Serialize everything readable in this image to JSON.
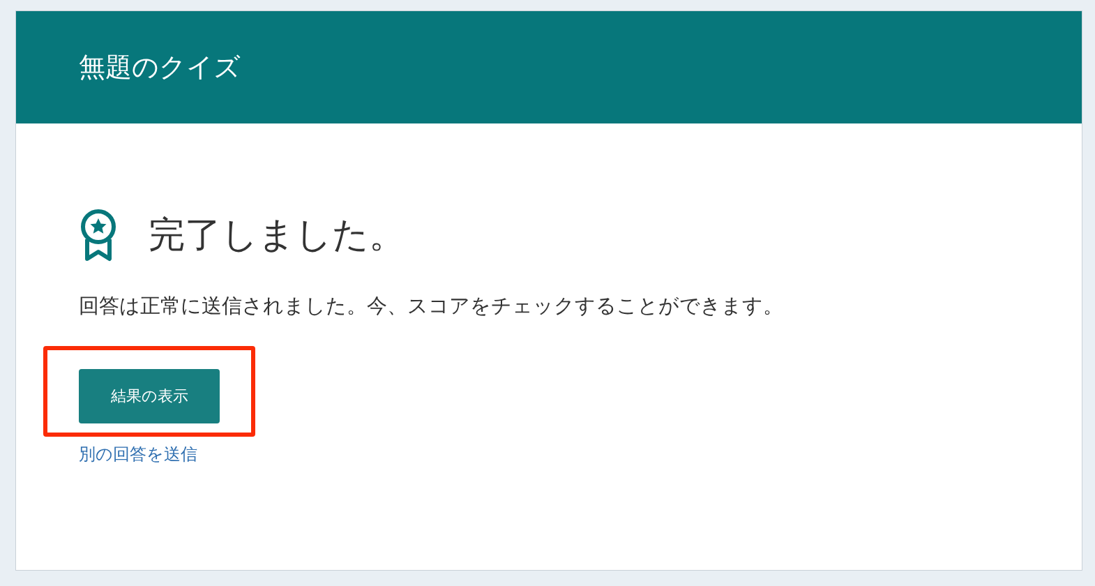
{
  "header": {
    "title": "無題のクイズ"
  },
  "completion": {
    "heading": "完了しました。",
    "message": "回答は正常に送信されました。今、スコアをチェックすることができます。"
  },
  "results_button": {
    "label": "結果の表示",
    "highlighted": true
  },
  "another_response_link": {
    "label": "別の回答を送信"
  }
}
